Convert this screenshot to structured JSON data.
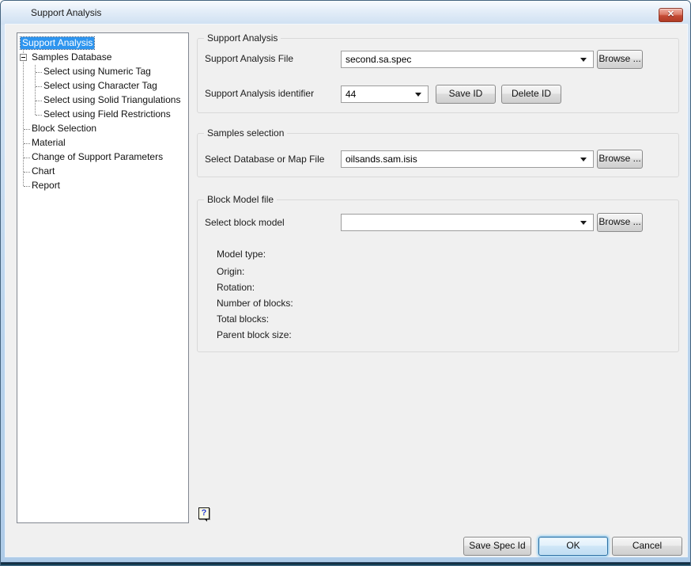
{
  "window": {
    "title": "Support Analysis"
  },
  "icons": {
    "close": "✕",
    "help": "?",
    "dropdown_arrow": "triangle-down",
    "tree_expander": "minus-box"
  },
  "colors": {
    "selection_blue": "#2e95ef",
    "frame_blue": "#b9d3ec",
    "close_red": "#c44b35",
    "content_gray": "#f0f0f0"
  },
  "tree": {
    "items": [
      {
        "label": "Support Analysis",
        "depth": 0,
        "selected": true,
        "expander": false
      },
      {
        "label": "Samples Database",
        "depth": 1,
        "selected": false,
        "expander": true
      },
      {
        "label": "Select using Numeric Tag",
        "depth": 2,
        "selected": false,
        "expander": false
      },
      {
        "label": "Select using Character Tag",
        "depth": 2,
        "selected": false,
        "expander": false
      },
      {
        "label": "Select using Solid Triangulations",
        "depth": 2,
        "selected": false,
        "expander": false
      },
      {
        "label": "Select using Field Restrictions",
        "depth": 2,
        "selected": false,
        "expander": false
      },
      {
        "label": "Block Selection",
        "depth": 1,
        "selected": false,
        "expander": false
      },
      {
        "label": "Material",
        "depth": 1,
        "selected": false,
        "expander": false
      },
      {
        "label": "Change of Support Parameters",
        "depth": 1,
        "selected": false,
        "expander": false
      },
      {
        "label": "Chart",
        "depth": 1,
        "selected": false,
        "expander": false
      },
      {
        "label": "Report",
        "depth": 1,
        "selected": false,
        "expander": false
      }
    ]
  },
  "groups": {
    "support_analysis": {
      "title": "Support Analysis",
      "file_label": "Support Analysis File",
      "file_value": "second.sa.spec",
      "browse_label": "Browse ...",
      "identifier_label": "Support Analysis identifier",
      "identifier_value": "44",
      "save_id_label": "Save ID",
      "delete_id_label": "Delete ID"
    },
    "samples_selection": {
      "title": "Samples selection",
      "db_label": "Select Database or Map File",
      "db_value": "oilsands.sam.isis",
      "browse_label": "Browse ..."
    },
    "block_model": {
      "title": "Block Model file",
      "select_label": "Select block model",
      "select_value": "",
      "browse_label": "Browse ...",
      "info_labels": [
        "Model type:",
        "Origin:",
        "Rotation:",
        "Number of blocks:",
        "Total blocks:",
        "Parent block size:"
      ]
    }
  },
  "footer": {
    "save_spec_label": "Save Spec Id",
    "ok_label": "OK",
    "cancel_label": "Cancel"
  }
}
